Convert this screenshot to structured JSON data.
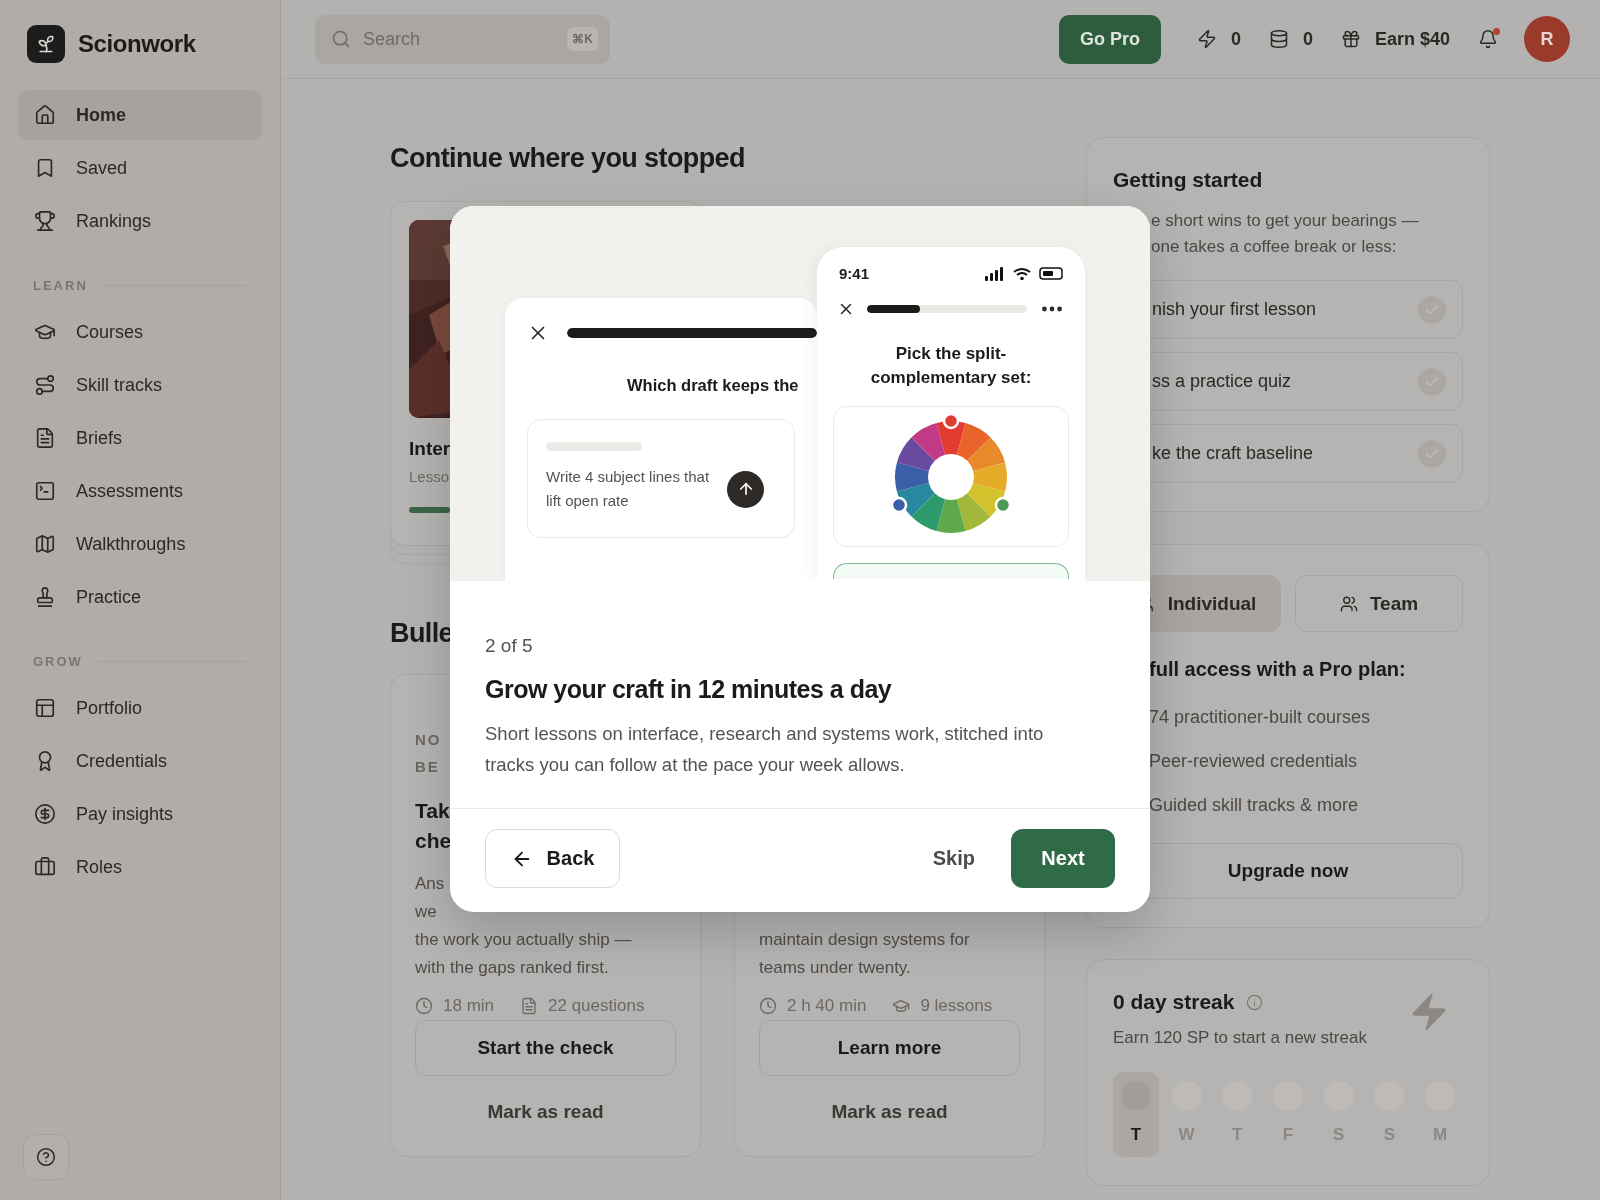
{
  "sidebar": {
    "brand": "Scionwork",
    "items": [
      {
        "label": "Home",
        "selected": true
      },
      {
        "label": "Saved",
        "selected": false
      },
      {
        "label": "Rankings",
        "selected": false
      }
    ],
    "sections": [
      {
        "title": "LEARN",
        "items": [
          {
            "label": "Courses",
            "selected": false
          },
          {
            "label": "Skill tracks",
            "selected": false
          },
          {
            "label": "Briefs",
            "selected": false
          },
          {
            "label": "Assessments",
            "selected": false
          },
          {
            "label": "Walkthroughs",
            "selected": false
          },
          {
            "label": "Practice",
            "selected": false
          }
        ]
      },
      {
        "title": "GROW",
        "items": [
          {
            "label": "Portfolio",
            "selected": false
          },
          {
            "label": "Credentials",
            "selected": false
          },
          {
            "label": "Pay insights",
            "selected": false
          },
          {
            "label": "Roles",
            "selected": false
          }
        ]
      }
    ]
  },
  "topbar": {
    "search": {
      "placeholder": "Search",
      "shortcut": "⌘K"
    },
    "go_pro": "Go Pro",
    "energy": "0",
    "coins": "0",
    "earn": "Earn $40",
    "notifications_unread": true,
    "avatar": "R"
  },
  "continue": {
    "title": "Continue where you stopped",
    "cards": [
      {
        "title": "Inter",
        "subtitle": "Lesso",
        "progress": {
          "level": 0.15
        }
      }
    ]
  },
  "bulletin": {
    "title": "Bulle",
    "cards": [
      {
        "eyebrow": [
          "NO",
          "BE"
        ],
        "title": [
          "Tak",
          "che"
        ],
        "lines": [
          "Ans",
          "we",
          "the work you actually ship —",
          "with the gaps ranked first."
        ],
        "meta": [
          {
            "kind": "time",
            "text": "18 min"
          },
          {
            "kind": "questions",
            "text": "22 questions"
          }
        ],
        "action": "Start the check",
        "dismiss": "Mark as read"
      },
      {
        "lines": [
          "maintain design systems for",
          "teams under twenty."
        ],
        "meta": [
          {
            "kind": "time",
            "text": "2 h 40 min"
          },
          {
            "kind": "lessons",
            "text": "9 lessons"
          }
        ],
        "action": "Learn more",
        "dismiss": "Mark as read"
      }
    ]
  },
  "getting_started": {
    "title": "Getting started",
    "description": [
      "e short wins to get your bearings —",
      "one takes a coffee break or less:"
    ],
    "tasks": [
      {
        "label": "nish your first lesson",
        "checked": false
      },
      {
        "label": "ss a practice quiz",
        "checked": false
      },
      {
        "label": "ke the craft baseline",
        "checked": false
      }
    ]
  },
  "plan": {
    "tabs": [
      {
        "label": "Individual",
        "selected": true
      },
      {
        "label": "Team",
        "selected": false
      }
    ],
    "heading": "full access with a Pro plan:",
    "features": [
      "74 practitioner-built courses",
      "Peer-reviewed credentials",
      "Guided skill tracks & more"
    ],
    "cta": "Upgrade now"
  },
  "streak": {
    "title": "0 day streak",
    "hint": "Earn 120 SP to start a new streak",
    "days": [
      {
        "label": "T",
        "selected": true
      },
      {
        "label": "W",
        "selected": false
      },
      {
        "label": "T",
        "selected": false
      },
      {
        "label": "F",
        "selected": false
      },
      {
        "label": "S",
        "selected": false
      },
      {
        "label": "S",
        "selected": false
      },
      {
        "label": "M",
        "selected": false
      }
    ]
  },
  "modal": {
    "preview": {
      "progress": {
        "level": 1
      },
      "prompt": "Which draft keeps the",
      "answer": "Write 4 subject lines that lift open rate",
      "phone": {
        "time": "9:41",
        "progress": {
          "level": 0.33
        },
        "question": "Pick the split-complementary set:"
      }
    },
    "step": "2 of 5",
    "title": "Grow your craft in 12 minutes a day",
    "body": "Short lessons on interface, research and systems work, stitched into tracks you can follow at the pace your week allows.",
    "back": "Back",
    "skip": "Skip",
    "next": "Next"
  }
}
